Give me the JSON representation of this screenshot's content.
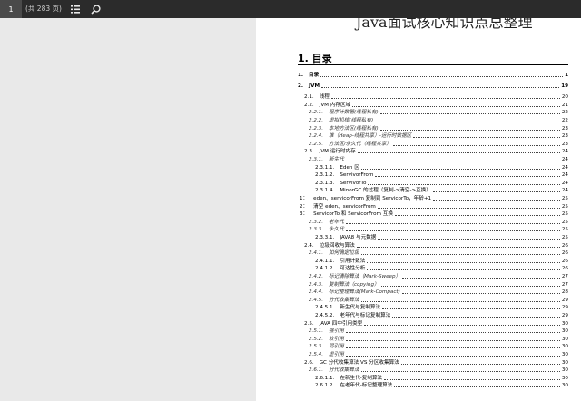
{
  "toolbar": {
    "page_number": "1",
    "page_count": "(共 283 页)",
    "outline_icon": "list-icon",
    "search_icon": "search-icon"
  },
  "document": {
    "header_title": "Java面试核心知识点总整理",
    "toc_title": "1. 目录",
    "toc": [
      {
        "num": "1.",
        "label": "目录",
        "page": "1",
        "level": 1
      },
      {
        "num": "2.",
        "label": "JVM",
        "page": "19",
        "level": 1
      },
      {
        "num": "2.1.",
        "label": "线程",
        "page": "20",
        "level": 2
      },
      {
        "num": "2.2.",
        "label": "JVM 内存区域",
        "page": "21",
        "level": 2
      },
      {
        "num": "2.2.1.",
        "label": "程序计数器(线程私有)",
        "page": "22",
        "level": 3
      },
      {
        "num": "2.2.2.",
        "label": "虚拟机栈(线程私有)",
        "page": "22",
        "level": 3
      },
      {
        "num": "2.2.3.",
        "label": "本地方法区(线程私有)",
        "page": "23",
        "level": 3
      },
      {
        "num": "2.2.4.",
        "label": "堆（Heap-线程共享）-运行时数据区",
        "page": "23",
        "level": 3
      },
      {
        "num": "2.2.5.",
        "label": "方法区/永久代（线程共享）",
        "page": "23",
        "level": 3
      },
      {
        "num": "2.3.",
        "label": "JVM 运行时内存",
        "page": "24",
        "level": 2
      },
      {
        "num": "2.3.1.",
        "label": "新生代",
        "page": "24",
        "level": 3
      },
      {
        "num": "2.3.1.1.",
        "label": "Eden 区",
        "page": "24",
        "level": 4
      },
      {
        "num": "2.3.1.2.",
        "label": "ServivorFrom",
        "page": "24",
        "level": 4
      },
      {
        "num": "2.3.1.3.",
        "label": "ServivorTo",
        "page": "24",
        "level": 4
      },
      {
        "num": "2.3.1.4.",
        "label": "MinorGC 的过程（复制->清空->互换）",
        "page": "24",
        "level": 4
      },
      {
        "num": "1：",
        "label": "eden、servicorFrom 复制到 ServicorTo，年龄+1",
        "page": "25",
        "level": 5
      },
      {
        "num": "2：",
        "label": "清空 eden、servicorFrom",
        "page": "25",
        "level": 5
      },
      {
        "num": "3：",
        "label": "ServicorTo 和 ServicorFrom 互换",
        "page": "25",
        "level": 5
      },
      {
        "num": "2.3.2.",
        "label": "老年代",
        "page": "25",
        "level": 3
      },
      {
        "num": "2.3.3.",
        "label": "永久代",
        "page": "25",
        "level": 3
      },
      {
        "num": "2.3.3.1.",
        "label": "JAVA8 与元数据",
        "page": "25",
        "level": 4
      },
      {
        "num": "2.4.",
        "label": "垃圾回收与算法",
        "page": "26",
        "level": 2
      },
      {
        "num": "2.4.1.",
        "label": "如何确定垃圾",
        "page": "26",
        "level": 3
      },
      {
        "num": "2.4.1.1.",
        "label": "引用计数法",
        "page": "26",
        "level": 4
      },
      {
        "num": "2.4.1.2.",
        "label": "可达性分析",
        "page": "26",
        "level": 4
      },
      {
        "num": "2.4.2.",
        "label": "标记清除算法（Mark-Sweep）",
        "page": "27",
        "level": 3
      },
      {
        "num": "2.4.3.",
        "label": "复制算法（copying）",
        "page": "27",
        "level": 3
      },
      {
        "num": "2.4.4.",
        "label": "标记整理算法(Mark-Compact)",
        "page": "28",
        "level": 3
      },
      {
        "num": "2.4.5.",
        "label": "分代收集算法",
        "page": "29",
        "level": 3
      },
      {
        "num": "2.4.5.1.",
        "label": "新生代与复制算法",
        "page": "29",
        "level": 4
      },
      {
        "num": "2.4.5.2.",
        "label": "老年代与标记复制算法",
        "page": "29",
        "level": 4
      },
      {
        "num": "2.5.",
        "label": "JAVA 四中引用类型",
        "page": "30",
        "level": 2
      },
      {
        "num": "2.5.1.",
        "label": "强引用",
        "page": "30",
        "level": 3
      },
      {
        "num": "2.5.2.",
        "label": "软引用",
        "page": "30",
        "level": 3
      },
      {
        "num": "2.5.3.",
        "label": "弱引用",
        "page": "30",
        "level": 3
      },
      {
        "num": "2.5.4.",
        "label": "虚引用",
        "page": "30",
        "level": 3
      },
      {
        "num": "2.6.",
        "label": "GC 分代收集算法 VS 分区收集算法",
        "page": "30",
        "level": 2
      },
      {
        "num": "2.6.1.",
        "label": "分代收集算法",
        "page": "30",
        "level": 3
      },
      {
        "num": "2.6.1.1.",
        "label": "在新生代-复制算法",
        "page": "30",
        "level": 4
      },
      {
        "num": "2.6.1.2.",
        "label": "在老年代-标记整理算法",
        "page": "30",
        "level": 4
      }
    ]
  }
}
